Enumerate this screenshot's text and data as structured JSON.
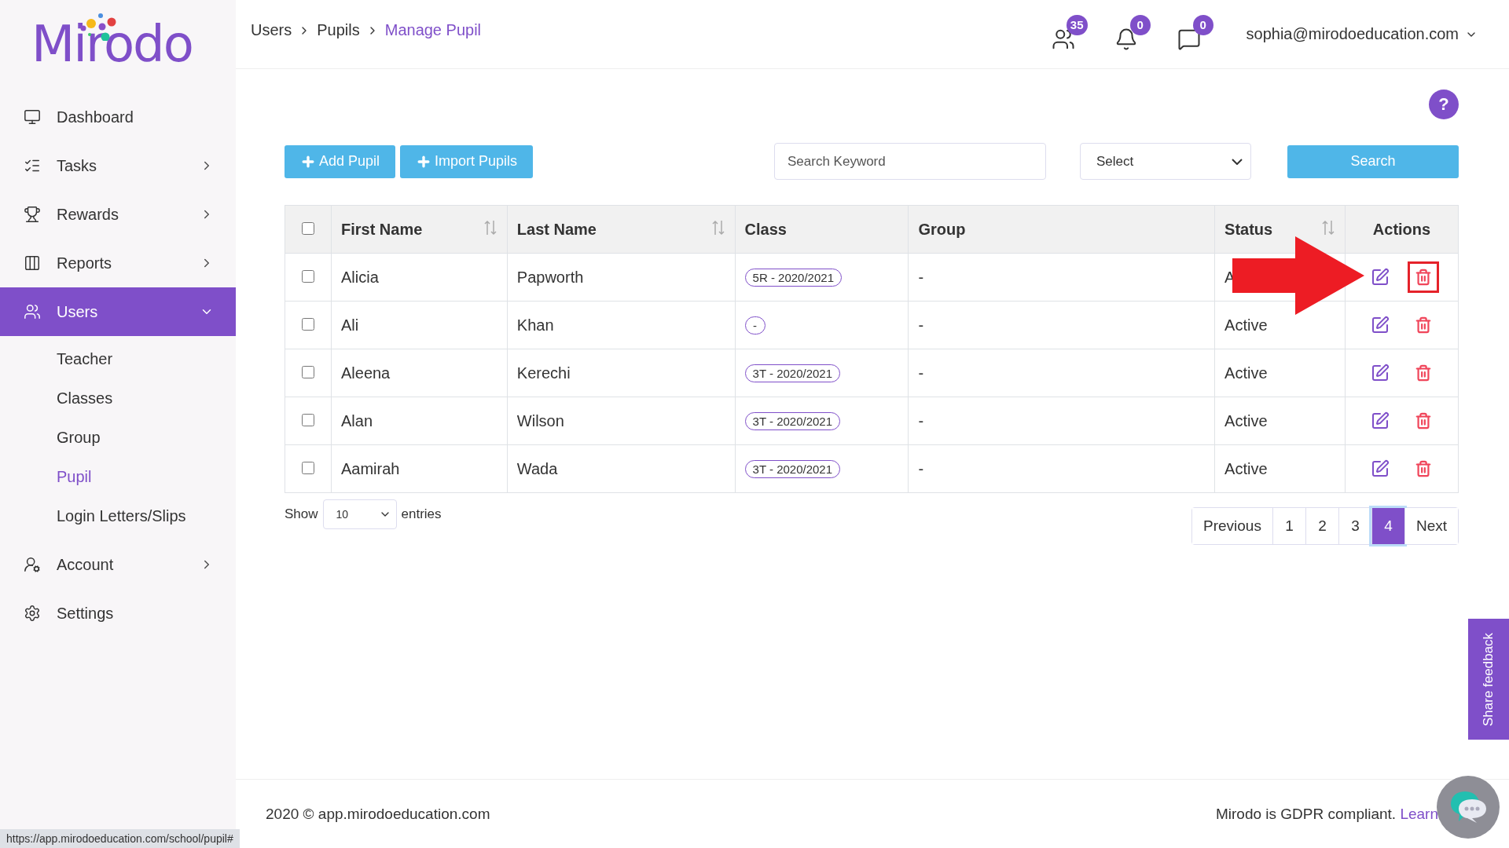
{
  "logo": {
    "text": "Mirodo"
  },
  "sidebar": {
    "items": [
      {
        "label": "Dashboard",
        "selected": false
      },
      {
        "label": "Tasks",
        "expanded": false,
        "selected": false
      },
      {
        "label": "Rewards",
        "expanded": false,
        "selected": false
      },
      {
        "label": "Reports",
        "expanded": false,
        "selected": false
      },
      {
        "label": "Users",
        "expanded": true,
        "selected": true,
        "children": [
          {
            "label": "Teacher",
            "selected": false
          },
          {
            "label": "Classes",
            "selected": false
          },
          {
            "label": "Group",
            "selected": false
          },
          {
            "label": "Pupil",
            "selected": true
          },
          {
            "label": "Login Letters/Slips",
            "selected": false
          }
        ]
      },
      {
        "label": "Account",
        "expanded": false,
        "selected": false
      },
      {
        "label": "Settings",
        "selected": false
      }
    ]
  },
  "breadcrumb": [
    {
      "label": "Users",
      "current": false
    },
    {
      "label": "Pupils",
      "current": false
    },
    {
      "label": "Manage Pupil",
      "current": true
    }
  ],
  "header": {
    "badges": [
      {
        "count": "35"
      },
      {
        "count": "0"
      },
      {
        "count": "0"
      }
    ],
    "user_email": "sophia@mirodoeducation.com"
  },
  "help_button": "?",
  "toolbar": {
    "buttons": [
      "Add Pupil",
      "Import Pupils"
    ],
    "search": {
      "placeholder": "Search Keyword"
    },
    "select": {
      "value": "Select"
    },
    "search_button": "Search"
  },
  "table": {
    "select_all_checked": false,
    "columns": [
      {
        "label": "First Name",
        "sortable": true
      },
      {
        "label": "Last Name",
        "sortable": true
      },
      {
        "label": "Class",
        "sortable": false
      },
      {
        "label": "Group",
        "sortable": false
      },
      {
        "label": "Status",
        "sortable": true
      },
      {
        "label": "Actions",
        "sortable": false
      }
    ],
    "rows": [
      {
        "checked": false,
        "first_name": "Alicia",
        "last_name": "Papworth",
        "class": "5R - 2020/2021",
        "group": "-",
        "status": "A",
        "delete_highlighted": true
      },
      {
        "checked": false,
        "first_name": "Ali",
        "last_name": "Khan",
        "class": "-",
        "group": "-",
        "status": "Active",
        "delete_highlighted": false
      },
      {
        "checked": false,
        "first_name": "Aleena",
        "last_name": "Kerechi",
        "class": "3T - 2020/2021",
        "group": "-",
        "status": "Active",
        "delete_highlighted": false
      },
      {
        "checked": false,
        "first_name": "Alan",
        "last_name": "Wilson",
        "class": "3T - 2020/2021",
        "group": "-",
        "status": "Active",
        "delete_highlighted": false
      },
      {
        "checked": false,
        "first_name": "Aamirah",
        "last_name": "Wada",
        "class": "3T - 2020/2021",
        "group": "-",
        "status": "Active",
        "delete_highlighted": false
      }
    ]
  },
  "entries": {
    "before": "Show",
    "value": "10",
    "after": "entries"
  },
  "pagination": {
    "previous": "Previous",
    "pages": [
      {
        "label": "1",
        "selected": false
      },
      {
        "label": "2",
        "selected": false
      },
      {
        "label": "3",
        "selected": false
      },
      {
        "label": "4",
        "selected": true
      }
    ],
    "next": "Next"
  },
  "footer": {
    "copyright": "2020 © app.mirodoeducation.com",
    "gdpr": "Mirodo is GDPR compliant.",
    "link": "Learn"
  },
  "feedback_tab": "Share feedback",
  "status_url": "https://app.mirodoeducation.com/school/pupil#"
}
